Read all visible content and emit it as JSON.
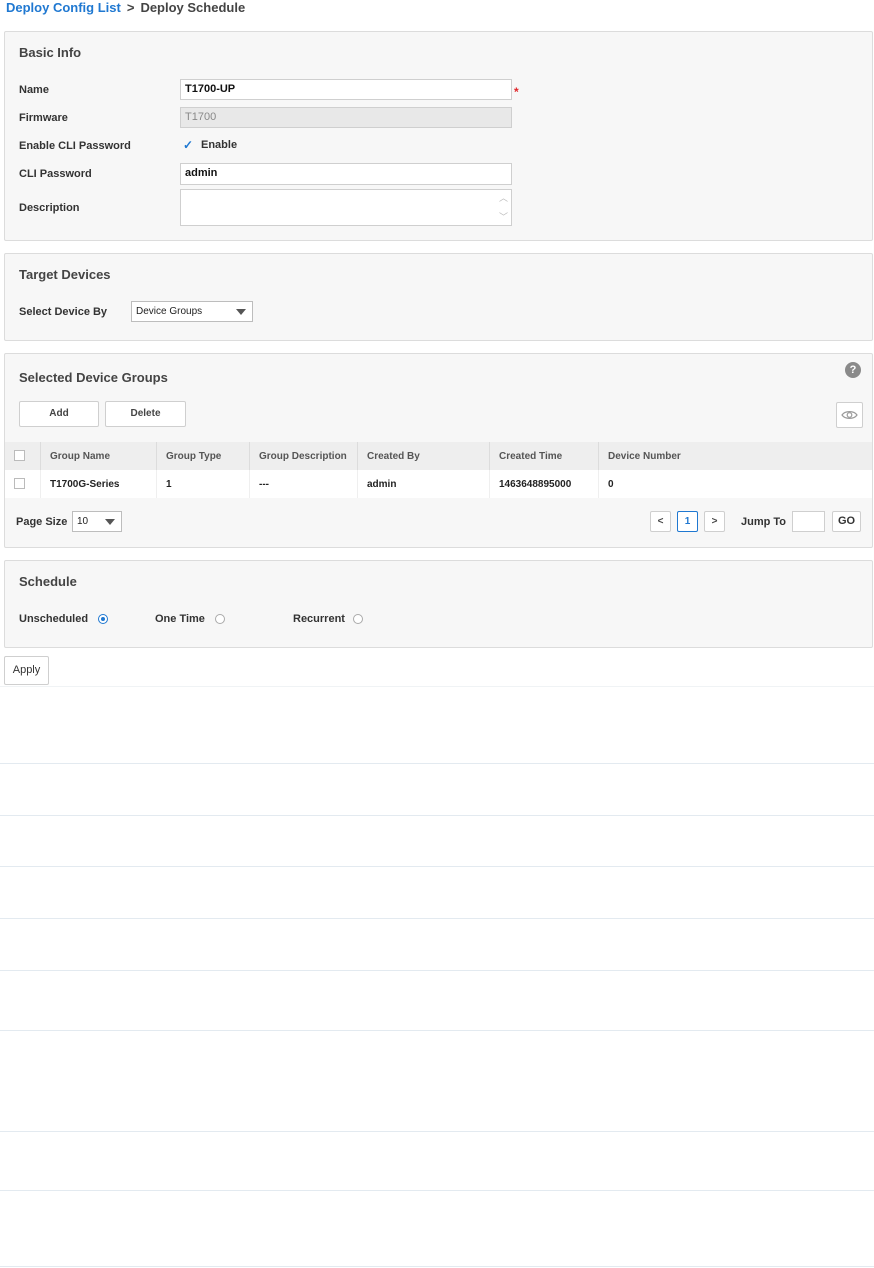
{
  "breadcrumb": {
    "parent": "Deploy Config List",
    "separator": ">",
    "current": "Deploy Schedule"
  },
  "basic_info": {
    "title": "Basic Info",
    "name_label": "Name",
    "name_value": "T1700-UP",
    "required_mark": "*",
    "firmware_label": "Firmware",
    "firmware_value": "T1700",
    "enable_cli_label": "Enable CLI Password",
    "enable_checkbox_label": "Enable",
    "enable_checked": true,
    "cli_password_label": "CLI Password",
    "cli_password_value": "admin",
    "description_label": "Description",
    "description_value": ""
  },
  "target_devices": {
    "title": "Target Devices",
    "select_by_label": "Select Device By",
    "select_by_value": "Device Groups"
  },
  "selected_groups": {
    "title": "Selected Device Groups",
    "help_icon": "?",
    "add_label": "Add",
    "delete_label": "Delete",
    "columns": [
      "Group Name",
      "Group Type",
      "Group Description",
      "Created By",
      "Created Time",
      "Device Number"
    ],
    "rows": [
      [
        "T1700G-Series",
        "1",
        "---",
        "admin",
        "1463648895000",
        "0"
      ]
    ],
    "page_size_label": "Page Size",
    "page_size_value": "10",
    "prev_label": "<",
    "current_page": "1",
    "next_label": ">",
    "jump_to_label": "Jump To",
    "jump_to_value": "",
    "go_label": "GO"
  },
  "schedule": {
    "title": "Schedule",
    "options": [
      "Unscheduled",
      "One Time",
      "Recurrent"
    ],
    "selected": "Unscheduled"
  },
  "apply_label": "Apply",
  "colors": {
    "accent": "#1f78d1",
    "required": "#e0262a",
    "panel_bg": "#f7f7f7"
  }
}
